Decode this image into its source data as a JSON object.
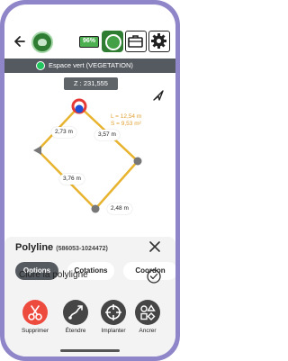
{
  "header": {
    "battery_text": "96%",
    "icons": [
      "back-arrow-icon",
      "app-logo",
      "battery-icon",
      "gps-icon",
      "briefcase-icon",
      "gear-icon"
    ]
  },
  "layer": {
    "name": "Espace vert (VEGETATION)",
    "status_color": "#22c55e"
  },
  "elevation": "Z : 231,555",
  "map": {
    "segment_labels": [
      "2,73 m",
      "3,57 m",
      "3,76 m",
      "2,48 m"
    ],
    "length_label": "L = 12,54 m",
    "area_label": "S = 9,53 m²",
    "line_color": "#e8b430",
    "vertex_color": "#777777"
  },
  "panel": {
    "title": "Polyline",
    "object_id": "(586053-1024472)",
    "tabs": [
      "Options",
      "Cotations",
      "Coordon"
    ],
    "close_polyline_label": "Clore la polyligne",
    "actions": [
      {
        "label": "Supprimer",
        "icon": "scissors-icon",
        "color": "#ee4b3f"
      },
      {
        "label": "Étendre",
        "icon": "extend-icon",
        "color": "#454545"
      },
      {
        "label": "Implanter",
        "icon": "target-icon",
        "color": "#454545"
      },
      {
        "label": "Ancrer",
        "icon": "shapes-icon",
        "color": "#454545"
      }
    ]
  }
}
